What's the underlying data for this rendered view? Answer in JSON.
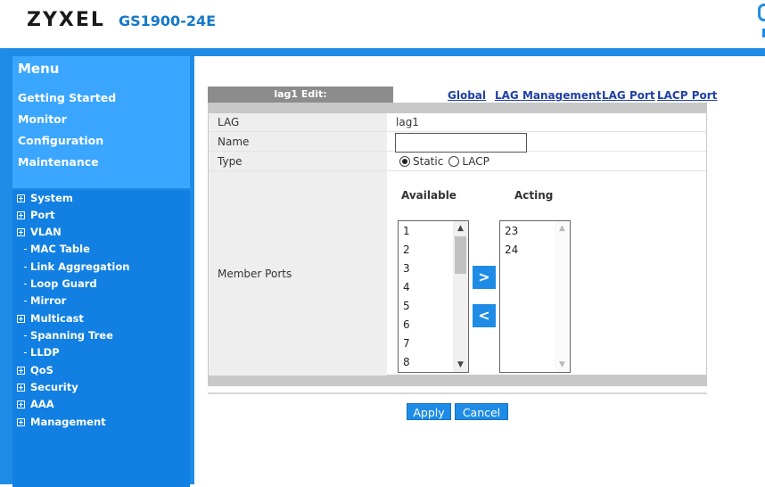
{
  "header": {
    "brand": "ZYXEL",
    "model": "GS1900-24E"
  },
  "menu": {
    "title": "Menu",
    "links": [
      "Getting Started",
      "Monitor",
      "Configuration",
      "Maintenance"
    ]
  },
  "tree": [
    {
      "label": "System",
      "type": "group"
    },
    {
      "label": "Port",
      "type": "group"
    },
    {
      "label": "VLAN",
      "type": "group"
    },
    {
      "label": "MAC Table",
      "type": "leaf"
    },
    {
      "label": "Link Aggregation",
      "type": "leaf"
    },
    {
      "label": "Loop Guard",
      "type": "leaf"
    },
    {
      "label": "Mirror",
      "type": "leaf"
    },
    {
      "label": "Multicast",
      "type": "group"
    },
    {
      "label": "Spanning Tree",
      "type": "leaf"
    },
    {
      "label": "LLDP",
      "type": "leaf"
    },
    {
      "label": "QoS",
      "type": "group"
    },
    {
      "label": "Security",
      "type": "group"
    },
    {
      "label": "AAA",
      "type": "group"
    },
    {
      "label": "Management",
      "type": "group"
    }
  ],
  "page": {
    "title": "lag1 Edit:",
    "tabs": [
      "Global",
      "LAG Management",
      "LAG Port",
      "LACP Port"
    ]
  },
  "form": {
    "lag_label": "LAG",
    "lag_value": "lag1",
    "name_label": "Name",
    "name_value": "",
    "type_label": "Type",
    "type_options": [
      "Static",
      "LACP"
    ],
    "type_selected": "Static",
    "member_ports_label": "Member Ports",
    "available_head": "Available",
    "acting_head": "Acting",
    "available_ports": [
      "1",
      "2",
      "3",
      "4",
      "5",
      "6",
      "7",
      "8"
    ],
    "acting_ports": [
      "23",
      "24"
    ],
    "add_glyph": ">",
    "remove_glyph": "<"
  },
  "buttons": {
    "apply": "Apply",
    "cancel": "Cancel"
  },
  "colors": {
    "accent": "#1e8ce6",
    "menu_box": "#3aa6ff",
    "link": "#1f3fa6"
  }
}
